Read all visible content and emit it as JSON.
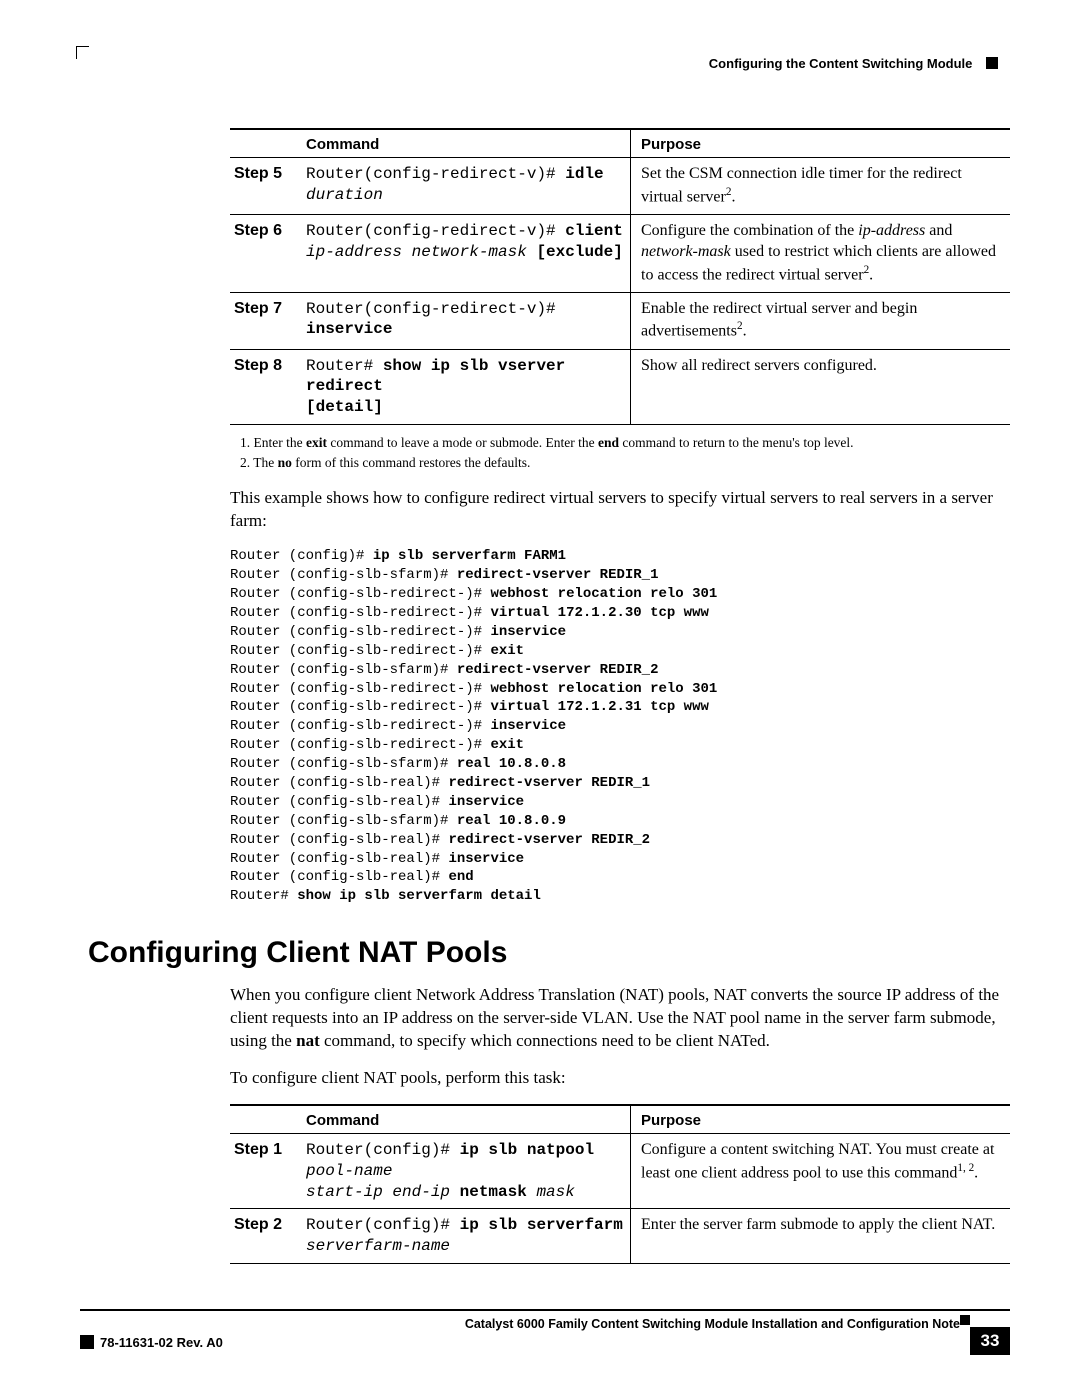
{
  "header": {
    "section": "Configuring the Content Switching Module"
  },
  "table1": {
    "headers": {
      "command": "Command",
      "purpose": "Purpose"
    },
    "rows": [
      {
        "step": "Step 5",
        "cmd_prefix": "Router(config-redirect-v)# ",
        "cmd_kw": "idle ",
        "cmd_arg": "duration",
        "cmd_suffix": "",
        "purpose_pre": "Set the CSM connection idle timer for the redirect virtual server",
        "purpose_sup": "2",
        "purpose_post": "."
      },
      {
        "step": "Step 6",
        "cmd_prefix": "Router(config-redirect-v)# ",
        "cmd_kw": "client",
        "cmd_line2_arg": "ip-address network-mask ",
        "cmd_line2_kw": "[exclude]",
        "purpose_html": "Configure the combination of the ",
        "purpose_it1": "ip-address",
        "purpose_mid1": " and ",
        "purpose_it2": "network-mask",
        "purpose_mid2": " used to restrict which clients are allowed to access the redirect virtual server",
        "purpose_sup": "2",
        "purpose_post": "."
      },
      {
        "step": "Step 7",
        "cmd_prefix": "Router(config-redirect-v)# ",
        "cmd_kw": "inservice",
        "purpose_pre": "Enable the redirect virtual server and begin advertisements",
        "purpose_sup": "2",
        "purpose_post": "."
      },
      {
        "step": "Step 8",
        "cmd_prefix": "Router# ",
        "cmd_kw": "show ip slb vserver redirect",
        "cmd_line2_kw": "[detail]",
        "purpose_pre": "Show all redirect servers configured."
      }
    ]
  },
  "footnotes": {
    "n1_pre": "1.   Enter the ",
    "n1_b1": "exit",
    "n1_mid": " command to leave a mode or submode. Enter the ",
    "n1_b2": "end",
    "n1_post": " command to return to the menu's  top level.",
    "n2_pre": "2.   The ",
    "n2_b": "no",
    "n2_post": " form of this command restores the defaults."
  },
  "para1": "This example shows how to configure redirect virtual servers to specify virtual servers to real servers in a server farm:",
  "example": {
    "l1p": "Router (config)# ",
    "l1b": "ip slb serverfarm FARM1",
    "l2p": "Router (config-slb-sfarm)# ",
    "l2b": "redirect-vserver REDIR_1",
    "l3p": "Router (config-slb-redirect-)# ",
    "l3b": "webhost relocation relo 301",
    "l4p": "Router (config-slb-redirect-)# ",
    "l4b": "virtual 172.1.2.30 tcp www",
    "l5p": "Router (config-slb-redirect-)# ",
    "l5b": "inservice",
    "l6p": "Router (config-slb-redirect-)# ",
    "l6b": "exit",
    "l7p": "Router (config-slb-sfarm)# ",
    "l7b": "redirect-vserver REDIR_2",
    "l8p": "Router (config-slb-redirect-)# ",
    "l8b": "webhost relocation relo 301",
    "l9p": "Router (config-slb-redirect-)# ",
    "l9b": "virtual 172.1.2.31 tcp www",
    "l10p": "Router (config-slb-redirect-)# ",
    "l10b": "inservice",
    "l11p": "Router (config-slb-redirect-)# ",
    "l11b": "exit",
    "l12p": "Router (config-slb-sfarm)# ",
    "l12b": "real 10.8.0.8",
    "l13p": "Router (config-slb-real)# ",
    "l13b": "redirect-vserver REDIR_1",
    "l14p": "Router (config-slb-real)# ",
    "l14b": "inservice",
    "l15p": "Router (config-slb-sfarm)# ",
    "l15b": "real 10.8.0.9",
    "l16p": "Router (config-slb-real)# ",
    "l16b": "redirect-vserver REDIR_2",
    "l17p": "Router (config-slb-real)# ",
    "l17b": "inservice",
    "l18p": "Router (config-slb-real)# ",
    "l18b": "end",
    "l19p": "Router# ",
    "l19b": "show ip slb serverfarm detail"
  },
  "section_heading": "Configuring Client NAT Pools",
  "para2_pre": "When you configure client Network Address Translation (NAT) pools, NAT converts the source IP address of the client requests into an IP address on the server-side VLAN. Use the NAT pool name in the server farm submode, using the ",
  "para2_b": "nat",
  "para2_post": " command, to specify which connections need to be client NATed.",
  "para3": "To configure client NAT pools, perform this task:",
  "table2": {
    "headers": {
      "command": "Command",
      "purpose": "Purpose"
    },
    "rows": [
      {
        "step": "Step 1",
        "cmd_prefix": "Router(config)# ",
        "cmd_kw": "ip slb natpool ",
        "cmd_arg": "pool-name",
        "cmd_line2_arg": "start-ip end-ip ",
        "cmd_line2_kw": "netmask ",
        "cmd_line2_arg2": "mask",
        "purpose_pre": "Configure a content switching NAT. You must create at least one client address pool to use this command",
        "purpose_sup": "1, 2",
        "purpose_post": "."
      },
      {
        "step": "Step 2",
        "cmd_prefix": "Router(config)# ",
        "cmd_kw": "ip slb serverfarm",
        "cmd_line2_arg": "serverfarm-name",
        "purpose_pre": "Enter the server farm submode to apply the client NAT."
      }
    ]
  },
  "footer": {
    "title": "Catalyst 6000 Family Content Switching Module Installation and Configuration Note",
    "rev": "78-11631-02 Rev. A0",
    "page": "33"
  }
}
